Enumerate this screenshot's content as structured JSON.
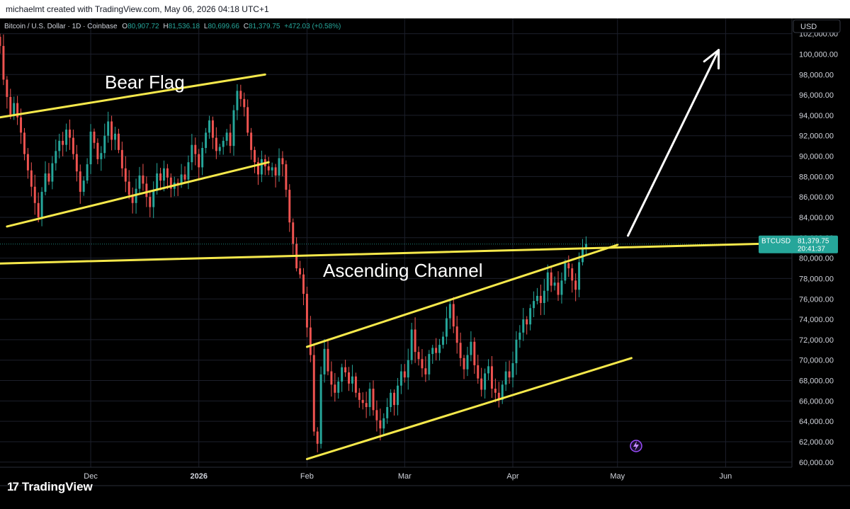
{
  "header": {
    "attribution": "michaelmt created with TradingView.com, May 06, 2026 04:18 UTC+1"
  },
  "legend": {
    "symbol": "Bitcoin / U.S. Dollar · 1D · Coinbase",
    "o_label": "O",
    "o_value": "80,907.72",
    "h_label": "H",
    "h_value": "81,536.18",
    "l_label": "L",
    "l_value": "80,699.66",
    "c_label": "C",
    "c_value": "81,379.75",
    "change": "+472.03 (+0.58%)"
  },
  "currency_button": "USD",
  "price_tag": {
    "ticker": "BTCUSD",
    "price": "81,379.75",
    "countdown": "20:41:37"
  },
  "annotations": {
    "bear_flag": "Bear Flag",
    "ascending_channel": "Ascending Channel"
  },
  "brand": {
    "name": "TradingView"
  },
  "colors": {
    "up": "#26a69a",
    "down": "#ef5350",
    "trendline": "#f5e84b",
    "arrow": "#ffffff",
    "background": "#000000",
    "grid": "#1c1f2b"
  },
  "chart_data": {
    "type": "candlestick",
    "ylim": [
      59500,
      103500
    ],
    "y_ticks": [
      60000,
      62000,
      64000,
      66000,
      68000,
      70000,
      72000,
      74000,
      76000,
      78000,
      80000,
      82000,
      84000,
      86000,
      88000,
      90000,
      92000,
      94000,
      96000,
      98000,
      100000,
      102000
    ],
    "y_tick_labels": [
      "60,000.00",
      "62,000.00",
      "64,000.00",
      "66,000.00",
      "68,000.00",
      "70,000.00",
      "72,000.00",
      "74,000.00",
      "76,000.00",
      "78,000.00",
      "80,000.00",
      "82,000.00",
      "84,000.00",
      "86,000.00",
      "88,000.00",
      "90,000.00",
      "92,000.00",
      "94,000.00",
      "96,000.00",
      "98,000.00",
      "100,000.00",
      "102,000.00"
    ],
    "x_range": [
      "2025-11-05",
      "2026-06-20"
    ],
    "x_ticks": [
      {
        "date": "2025-12-01",
        "label": "Dec",
        "bold": false
      },
      {
        "date": "2026-01-01",
        "label": "2026",
        "bold": true
      },
      {
        "date": "2026-02-01",
        "label": "Feb",
        "bold": false
      },
      {
        "date": "2026-03-01",
        "label": "Mar",
        "bold": false
      },
      {
        "date": "2026-04-01",
        "label": "Apr",
        "bold": false
      },
      {
        "date": "2026-05-01",
        "label": "May",
        "bold": false
      },
      {
        "date": "2026-06-01",
        "label": "Jun",
        "bold": false
      }
    ],
    "series_start": "2025-11-05",
    "closes": [
      100800,
      97500,
      95800,
      94000,
      95200,
      93800,
      92300,
      90200,
      88600,
      87000,
      85400,
      84000,
      86500,
      88300,
      87500,
      89300,
      90500,
      91500,
      91100,
      92600,
      91800,
      90200,
      88500,
      86500,
      87600,
      89200,
      92400,
      91300,
      89700,
      90300,
      92000,
      93400,
      91600,
      92200,
      90600,
      88800,
      87500,
      86200,
      85400,
      86800,
      88100,
      87300,
      86000,
      85000,
      86600,
      88300,
      87600,
      88800,
      87900,
      86800,
      87400,
      87200,
      88200,
      87700,
      89400,
      91100,
      90200,
      88900,
      90800,
      92300,
      93500,
      91800,
      90500,
      90900,
      91500,
      92300,
      91000,
      94500,
      96400,
      95600,
      94800,
      92300,
      90600,
      89400,
      88200,
      89700,
      89000,
      88600,
      88900,
      88100,
      89800,
      89200,
      86700,
      83500,
      81400,
      79000,
      78400,
      76500,
      73200,
      70500,
      63000,
      61800,
      68600,
      71100,
      68900,
      67600,
      66800,
      67900,
      69300,
      68800,
      67700,
      68400,
      66800,
      66100,
      65800,
      65400,
      67200,
      65100,
      64100,
      63300,
      64300,
      65400,
      66800,
      65600,
      67500,
      68900,
      68300,
      70000,
      73000,
      70800,
      70100,
      69200,
      68600,
      70600,
      71200,
      70700,
      71500,
      72300,
      74100,
      75500,
      73300,
      71700,
      70200,
      69100,
      70500,
      71800,
      69500,
      68200,
      67100,
      68700,
      69400,
      67200,
      66800,
      66100,
      67600,
      68900,
      68300,
      69700,
      72000,
      72700,
      74000,
      73500,
      75100,
      75800,
      76300,
      75600,
      76800,
      78600,
      77300,
      77600,
      76400,
      77800,
      79500,
      79000,
      77800,
      76900,
      79600,
      80900,
      81380
    ]
  },
  "drawings": {
    "bear_flag_upper": [
      [
        "2025-11-05",
        93800
      ],
      [
        "2026-01-20",
        98000
      ]
    ],
    "bear_flag_lower": [
      [
        "2025-11-07",
        83100
      ],
      [
        "2026-01-21",
        89400
      ]
    ],
    "horizontal_level": [
      [
        "2025-10-28",
        79400
      ],
      [
        "2026-06-22",
        81500
      ]
    ],
    "channel_upper": [
      [
        "2026-02-01",
        71300
      ],
      [
        "2026-05-01",
        81300
      ]
    ],
    "channel_lower": [
      [
        "2026-02-01",
        60300
      ],
      [
        "2026-05-05",
        70200
      ]
    ],
    "breakout_arrow": [
      [
        "2026-05-04",
        82200
      ],
      [
        "2026-05-30",
        100400
      ]
    ]
  }
}
